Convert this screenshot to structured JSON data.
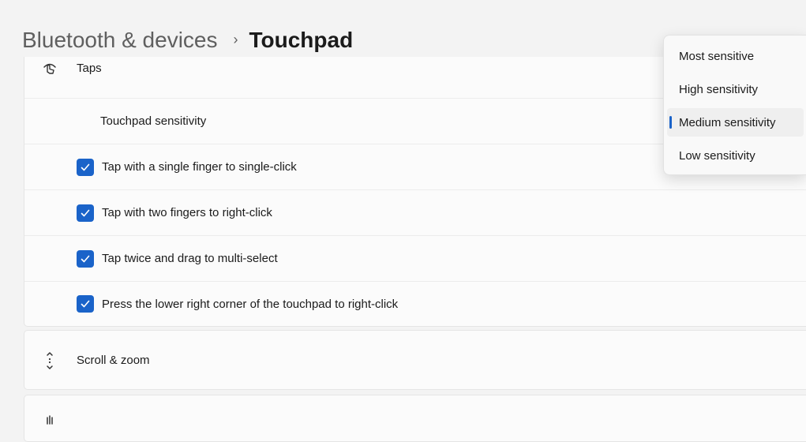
{
  "breadcrumb": {
    "parent": "Bluetooth & devices",
    "separator": "›",
    "current": "Touchpad"
  },
  "taps": {
    "header_label": "Taps",
    "header_icon": "tap-gesture-icon",
    "sensitivity_label": "Touchpad sensitivity",
    "options": [
      {
        "label": "Tap with a single finger to single-click",
        "checked": true
      },
      {
        "label": "Tap with two fingers to right-click",
        "checked": true
      },
      {
        "label": "Tap twice and drag to multi-select",
        "checked": true
      },
      {
        "label": "Press the lower right corner of the touchpad to right-click",
        "checked": true
      }
    ]
  },
  "scroll_zoom": {
    "label": "Scroll & zoom",
    "icon": "scroll-arrows-icon"
  },
  "sensitivity_dropdown": {
    "items": [
      {
        "label": "Most sensitive",
        "selected": false
      },
      {
        "label": "High sensitivity",
        "selected": false
      },
      {
        "label": "Medium sensitivity",
        "selected": true
      },
      {
        "label": "Low sensitivity",
        "selected": false
      }
    ]
  },
  "colors": {
    "accent": "#1a63c9",
    "background": "#f3f3f3",
    "card": "#fbfbfb"
  }
}
